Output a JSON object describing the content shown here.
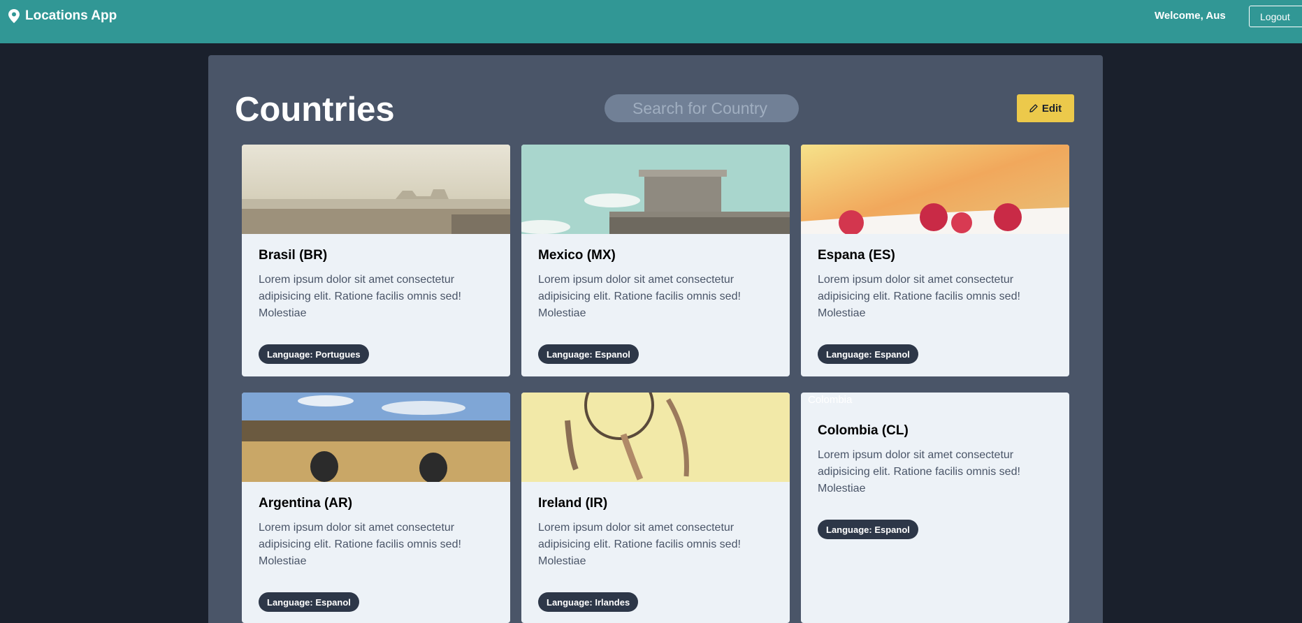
{
  "navbar": {
    "brand": "Locations App",
    "welcome": "Welcome, Aus",
    "logout_label": "Logout",
    "bg_color": "#319795"
  },
  "main": {
    "title": "Countries",
    "search_placeholder": "Search for Country",
    "edit_label": "Edit"
  },
  "cards": [
    {
      "title": "Brasil (BR)",
      "description": "Lorem ipsum dolor sit amet consectetur adipisicing elit. Ratione facilis omnis sed! Molestiae",
      "language": "Language: Portugues",
      "image": "beach"
    },
    {
      "title": "Mexico (MX)",
      "description": "Lorem ipsum dolor sit amet consectetur adipisicing elit. Ratione facilis omnis sed! Molestiae",
      "language": "Language: Espanol",
      "image": "bunker"
    },
    {
      "title": "Espana (ES)",
      "description": "Lorem ipsum dolor sit amet consectetur adipisicing elit. Ratione facilis omnis sed! Molestiae",
      "language": "Language: Espanol",
      "image": "raspberries"
    },
    {
      "title": "Argentina (AR)",
      "description": "Lorem ipsum dolor sit amet consectetur adipisicing elit. Ratione facilis omnis sed! Molestiae",
      "language": "Language: Espanol",
      "image": "field"
    },
    {
      "title": "Ireland (IR)",
      "description": "Lorem ipsum dolor sit amet consectetur adipisicing elit. Ratione facilis omnis sed! Molestiae",
      "language": "Language: Irlandes",
      "image": "dreamcatcher"
    },
    {
      "title": "Colombia (CL)",
      "description": "Lorem ipsum dolor sit amet consectetur adipisicing elit. Ratione facilis omnis sed! Molestiae",
      "language": "Language: Espanol",
      "image_alt": "Colombia"
    }
  ]
}
